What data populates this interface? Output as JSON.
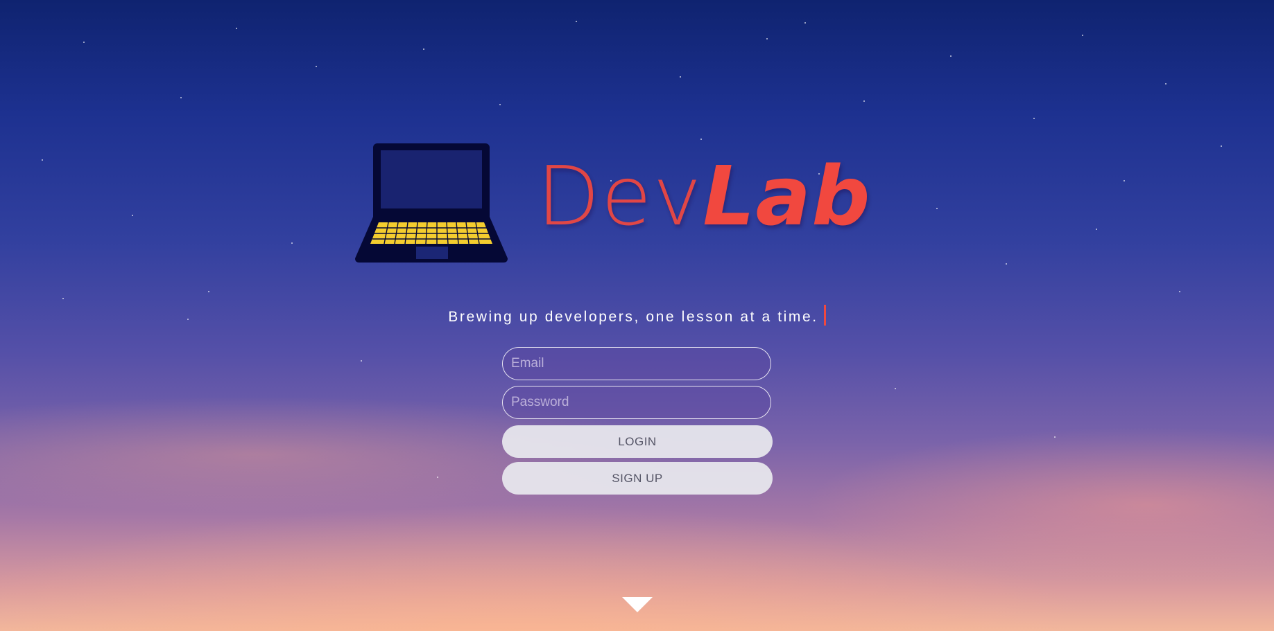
{
  "brand": {
    "name_part1": "Dev",
    "name_part2": "Lab",
    "logo_icon": "laptop-icon",
    "accent_color": "#f1483f"
  },
  "hero": {
    "tagline": "Brewing up developers, one lesson at a time."
  },
  "login_form": {
    "email_placeholder": "Email",
    "email_value": "",
    "password_placeholder": "Password",
    "password_value": "",
    "login_label": "LOGIN",
    "signup_label": "SIGN UP"
  },
  "scroll": {
    "icon": "chevron-down-icon"
  }
}
